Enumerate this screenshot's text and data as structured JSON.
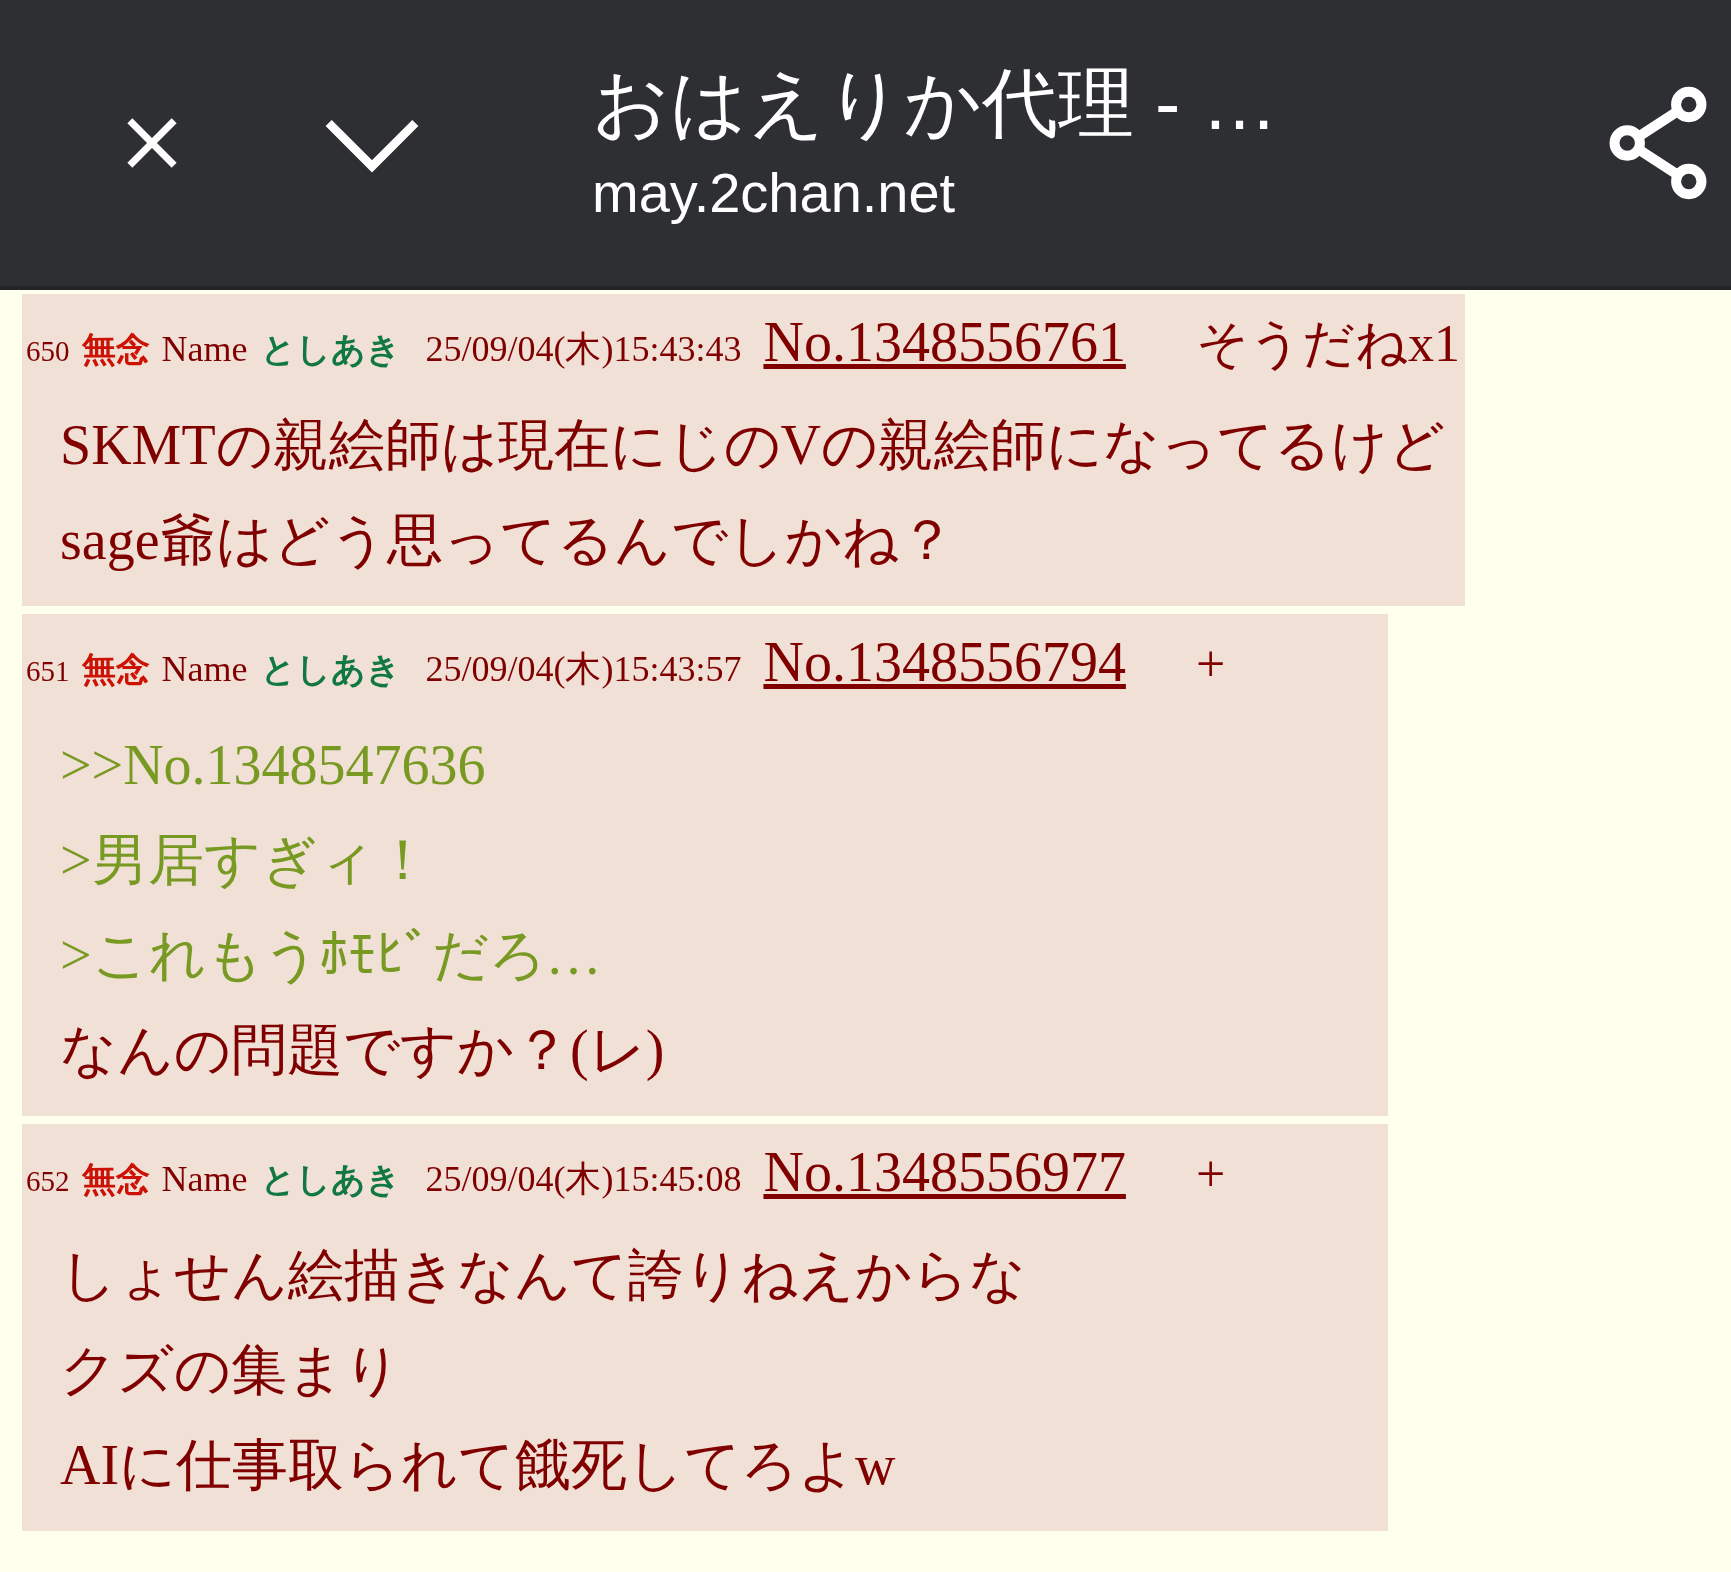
{
  "toolbar": {
    "title": "おはえりか代理 - …",
    "url": "may.2chan.net"
  },
  "posts": [
    {
      "number": "650",
      "mail": "無念",
      "name_label": "Name",
      "name": "としあき",
      "date": "25/09/04(木)15:43:43",
      "post_no": "No.1348556761",
      "sodane": "そうだねx1",
      "lines": [
        {
          "kind": "text",
          "text": "SKMTの親絵師は現在にじのVの親絵師になってるけど"
        },
        {
          "kind": "text",
          "text": "sage爺はどう思ってるんでしかね？"
        }
      ]
    },
    {
      "number": "651",
      "mail": "無念",
      "name_label": "Name",
      "name": "としあき",
      "date": "25/09/04(木)15:43:57",
      "post_no": "No.1348556794",
      "sodane": "+",
      "lines": [
        {
          "kind": "quote",
          "text": ">>No.1348547636"
        },
        {
          "kind": "quote",
          "text": ">男居すぎィ！"
        },
        {
          "kind": "quote",
          "text": ">これもうﾎﾓﾋﾞだろ…"
        },
        {
          "kind": "text",
          "text": "なんの問題ですか？(レ)"
        }
      ]
    },
    {
      "number": "652",
      "mail": "無念",
      "name_label": "Name",
      "name": "としあき",
      "date": "25/09/04(木)15:45:08",
      "post_no": "No.1348556977",
      "sodane": "+",
      "lines": [
        {
          "kind": "text",
          "text": "しょせん絵描きなんて誇りねえからな"
        },
        {
          "kind": "text",
          "text": "クズの集まり"
        },
        {
          "kind": "text",
          "text": "AIに仕事取られて餓死してろよw"
        }
      ]
    }
  ]
}
